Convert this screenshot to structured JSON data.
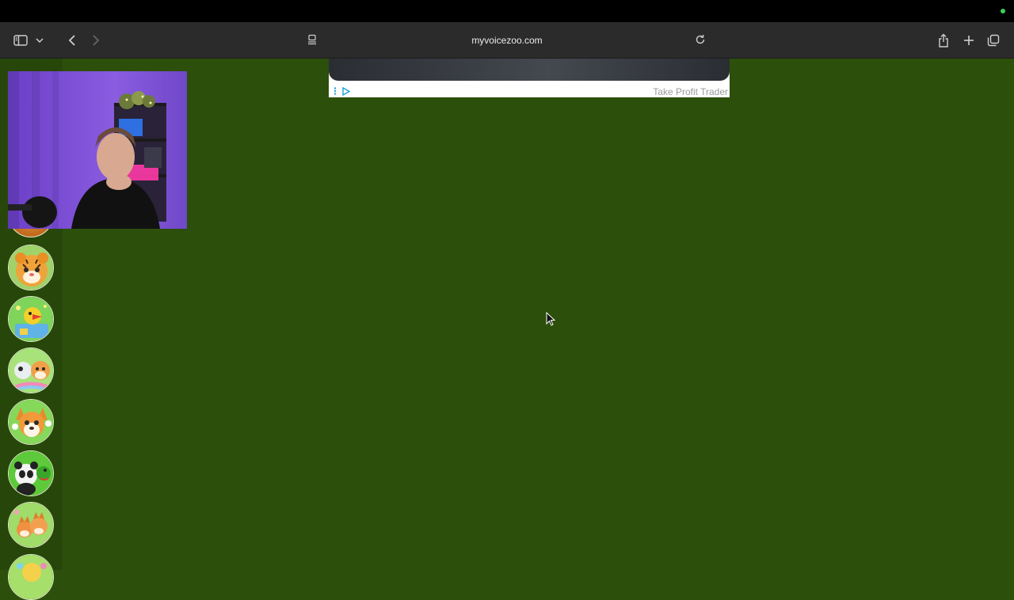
{
  "browser": {
    "url": "myvoicezoo.com"
  },
  "ad": {
    "advertiser": "Take Profit Trader"
  },
  "sidebar": {
    "avatars": [
      {
        "name": "tiger avatar"
      },
      {
        "name": "cartoon bird avatar"
      },
      {
        "name": "puppies avatar"
      },
      {
        "name": "corgi avatar"
      },
      {
        "name": "panda avatar"
      },
      {
        "name": "fox avatar"
      }
    ]
  },
  "colors": {
    "page_background": "#2c4f0b",
    "toolbar": "#2b2b2b",
    "status_dot": "#3ccf5a"
  }
}
